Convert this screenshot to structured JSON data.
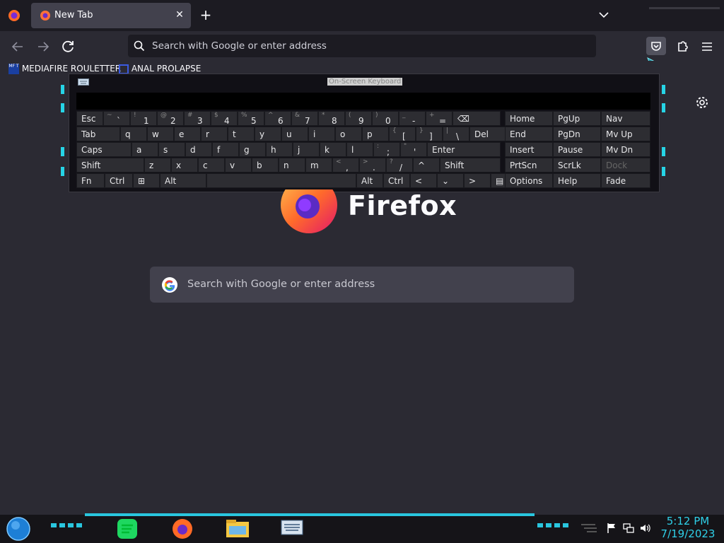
{
  "browser": {
    "tab": {
      "title": "New Tab"
    },
    "urlbar": {
      "placeholder": "Search with Google or enter address"
    },
    "bookmarks": [
      "MEDIAFIRE ROULETTER",
      "ANAL PROLAPSE"
    ]
  },
  "osk": {
    "title": "On-Screen Keyboard",
    "rows": [
      [
        {
          "k": "Esc"
        },
        {
          "s": "~",
          "k": "`"
        },
        {
          "s": "!",
          "k": "1"
        },
        {
          "s": "@",
          "k": "2"
        },
        {
          "s": "#",
          "k": "3"
        },
        {
          "s": "$",
          "k": "4"
        },
        {
          "s": "%",
          "k": "5"
        },
        {
          "s": "^",
          "k": "6"
        },
        {
          "s": "&",
          "k": "7"
        },
        {
          "s": "*",
          "k": "8"
        },
        {
          "s": "(",
          "k": "9"
        },
        {
          "s": ")",
          "k": "0"
        },
        {
          "s": "_",
          "k": "-"
        },
        {
          "s": "+",
          "k": "="
        },
        {
          "k": "⌫"
        }
      ],
      [
        {
          "k": "Tab"
        },
        {
          "k": "q"
        },
        {
          "k": "w"
        },
        {
          "k": "e"
        },
        {
          "k": "r"
        },
        {
          "k": "t"
        },
        {
          "k": "y"
        },
        {
          "k": "u"
        },
        {
          "k": "i"
        },
        {
          "k": "o"
        },
        {
          "k": "p"
        },
        {
          "s": "{",
          "k": "["
        },
        {
          "s": "}",
          "k": "]"
        },
        {
          "s": "|",
          "k": "\\"
        },
        {
          "k": "Del"
        }
      ],
      [
        {
          "k": "Caps"
        },
        {
          "k": "a"
        },
        {
          "k": "s"
        },
        {
          "k": "d"
        },
        {
          "k": "f"
        },
        {
          "k": "g"
        },
        {
          "k": "h"
        },
        {
          "k": "j"
        },
        {
          "k": "k"
        },
        {
          "k": "l"
        },
        {
          "s": ":",
          "k": ";"
        },
        {
          "s": "\"",
          "k": "'"
        },
        {
          "k": "Enter"
        }
      ],
      [
        {
          "k": "Shift"
        },
        {
          "k": "z"
        },
        {
          "k": "x"
        },
        {
          "k": "c"
        },
        {
          "k": "v"
        },
        {
          "k": "b"
        },
        {
          "k": "n"
        },
        {
          "k": "m"
        },
        {
          "s": "<",
          "k": ","
        },
        {
          "s": ">",
          "k": "."
        },
        {
          "s": "?",
          "k": "/"
        },
        {
          "k": "^"
        },
        {
          "k": "Shift"
        }
      ],
      [
        {
          "k": "Fn"
        },
        {
          "k": "Ctrl"
        },
        {
          "k": "⊞"
        },
        {
          "k": "Alt"
        },
        {
          "k": ""
        },
        {
          "k": "Alt"
        },
        {
          "k": "Ctrl"
        },
        {
          "k": "<"
        },
        {
          "k": "⌄"
        },
        {
          "k": ">"
        },
        {
          "k": "▤"
        }
      ]
    ],
    "side_keys": [
      [
        "Home",
        "PgUp",
        "Nav"
      ],
      [
        "End",
        "PgDn",
        "Mv Up"
      ],
      [
        "Insert",
        "Pause",
        "Mv Dn"
      ],
      [
        "PrtScn",
        "ScrLk",
        "Dock"
      ],
      [
        "Options",
        "Help",
        "Fade"
      ]
    ]
  },
  "newtab": {
    "brand": "Firefox",
    "search_placeholder": "Search with Google or enter address"
  },
  "taskbar": {
    "time": "5:12 PM",
    "date": "7/19/2023"
  }
}
